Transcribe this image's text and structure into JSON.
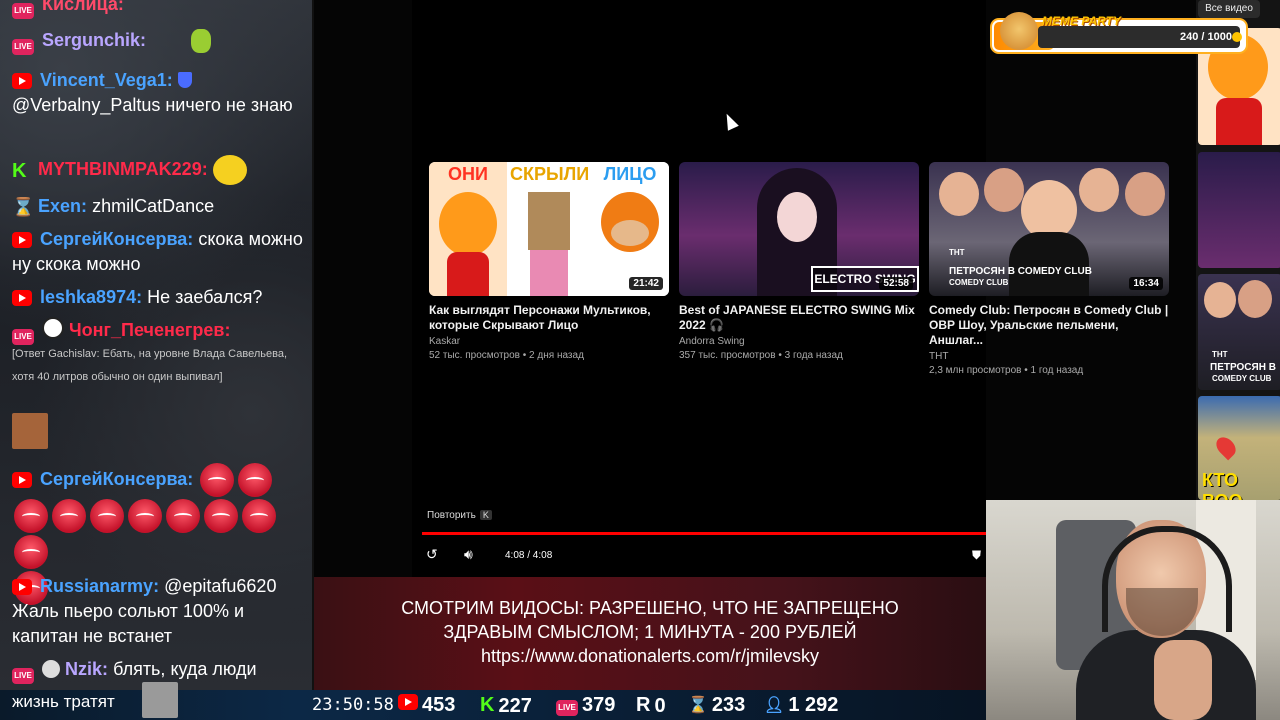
{
  "chat": {
    "top_partial": "Кислица:",
    "messages": [
      {
        "platform": "live",
        "nick": "Sergunchik:",
        "nick_color": "#b9a6ff",
        "text": ""
      },
      {
        "platform": "yt",
        "nick": "Vincent_Vega1:",
        "nick_color": "#4aa3ff",
        "text": "@Verbalny_Paltus ничего не знаю"
      },
      {
        "platform": "kick",
        "nick": "MYTHBINMPAK229:",
        "nick_color": "#ff2a4a",
        "text": ""
      },
      {
        "platform": "twitch",
        "nick": "Exen:",
        "nick_color": "#4aa3ff",
        "text": "zhmilCatDance"
      },
      {
        "platform": "yt",
        "nick": "СергейКонсерва:",
        "nick_color": "#4aa3ff",
        "text": "скока можно ну скока можно"
      },
      {
        "platform": "yt",
        "nick": "leshka8974:",
        "nick_color": "#4aa3ff",
        "text": "Не заебался?"
      },
      {
        "platform": "live",
        "nick": "Чонг_Печенегрев:",
        "nick_color": "#ff2a4a",
        "text": ""
      },
      {
        "platform": "",
        "nick": "",
        "nick_color": "#c8c8c8",
        "text": "[Ответ Gachislav: Ебать, на уровне Влада Савельева, хотя 40 литров обычно он один выпивал]"
      },
      {
        "platform": "yt",
        "nick": "СергейКонсерва:",
        "nick_color": "#4aa3ff",
        "text": ""
      },
      {
        "platform": "yt",
        "nick": "Russianarmy:",
        "nick_color": "#4aa3ff",
        "text": "@epitafu6620 Жаль пьеро сольют 100% и капитан не встанет"
      },
      {
        "platform": "live",
        "nick": "Nzik:",
        "nick_color": "#b9a6ff",
        "text": "блять, куда люди"
      }
    ],
    "last_line": "жизнь тратят"
  },
  "player": {
    "repeat_label": "Повторить",
    "repeat_key": "K",
    "time": "4:08 / 4:08",
    "progress": 1.0
  },
  "videos": [
    {
      "thumb_captions": [
        "ОНИ",
        "СКРЫЛИ",
        "ЛИЦО"
      ],
      "duration": "21:42",
      "title": "Как выглядят Персонажи Мультиков, которые Скрывают Лицо",
      "channel": "Kaskar",
      "meta": "52 тыс. просмотров • 2 дня назад"
    },
    {
      "thumb_captions": [
        "ELECTRO SWING"
      ],
      "duration": "52:58",
      "title": "Best of JAPANESE ELECTRO SWING Mix 2022 🎧",
      "channel": "Andorra Swing",
      "meta": "357 тыс. просмотров • 3 года назад"
    },
    {
      "thumb_captions": [
        "ТНТ",
        "ПЕТРОСЯН В COMEDY CLUB",
        "COMEDY CLUB"
      ],
      "duration": "16:34",
      "title": "Comedy Club: Петросян в Comedy Club | ОВР Шоу, Уральские пельмени, Аншлаг...",
      "channel": "ТНТ",
      "meta": "2,3 млн просмотров • 1 год назад"
    }
  ],
  "right_strip": {
    "all_videos_label": "Все видео",
    "captions": [
      "ТНТ",
      "ПЕТРОСЯН В",
      "COMEDY CLUB",
      "КТО ВОО"
    ]
  },
  "meme_party": {
    "title": "MEME PARTY",
    "count": "240 / 1000",
    "progress": 0.24
  },
  "banner": {
    "line1": "СМОТРИМ ВИДОСЫ: РАЗРЕШЕНО, ЧТО НЕ ЗАПРЕЩЕНО",
    "line2": "ЗДРАВЫМ СМЫСЛОМ; 1 МИНУТА - 200 РУБЛЕЙ",
    "line3": "https://www.donationalerts.com/r/jmilevsky"
  },
  "stats": {
    "clock": "23:50:58",
    "youtube": "453",
    "kick": "227",
    "live": "379",
    "rutube": "0",
    "twitch": "233",
    "total": "1 292"
  },
  "colors": {
    "youtube": "#ff0000",
    "kick": "#53fc18",
    "live": "#e0245e",
    "twitch": "#9146ff",
    "total": "#4aa3ff"
  }
}
